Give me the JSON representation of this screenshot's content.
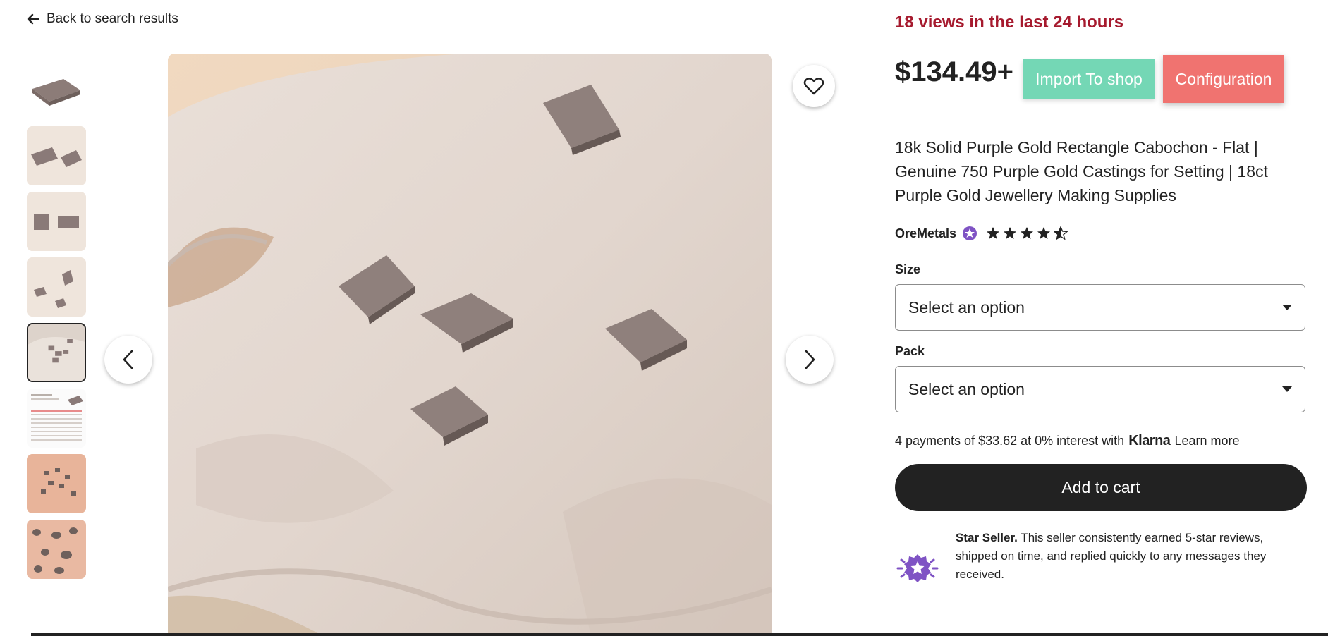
{
  "nav": {
    "back_label": "Back to search results"
  },
  "listing": {
    "views_text": "18 views in the last 24 hours",
    "price": "$134.49+",
    "title": "18k Solid Purple Gold Rectangle Cabochon - Flat | Genuine 750 Purple Gold Castings for Setting | 18ct Purple Gold Jewellery Making Supplies",
    "shop_name": "OreMetals",
    "rating_stars": 4.5
  },
  "toolbar": {
    "import_label": "Import To shop",
    "config_label": "Configuration"
  },
  "options": {
    "size_label": "Size",
    "size_value": "Select an option",
    "pack_label": "Pack",
    "pack_value": "Select an option"
  },
  "klarna": {
    "text": "4 payments of $33.62 at 0% interest with",
    "logo": "Klarna",
    "learn_more": "Learn more"
  },
  "cart": {
    "add_label": "Add to cart"
  },
  "star_seller": {
    "title": "Star Seller.",
    "description": "This seller consistently earned 5-star reviews, shipped on time, and replied quickly to any messages they received."
  },
  "gallery": {
    "thumbnail_count": 8,
    "selected_index": 4
  },
  "colors": {
    "views_red": "#a61a2e",
    "import_green": "#74d7b5",
    "config_coral": "#f07370",
    "cart_dark": "#222222",
    "star_seller_purple": "#7f53c4"
  },
  "icons": {
    "back": "arrow-left-icon",
    "prev": "chevron-left-icon",
    "next": "chevron-right-icon",
    "favorite": "heart-icon",
    "star_seller_badge": "star-seller-badge-icon",
    "shop_badge": "star-badge-icon",
    "dropdown": "caret-down-icon"
  }
}
